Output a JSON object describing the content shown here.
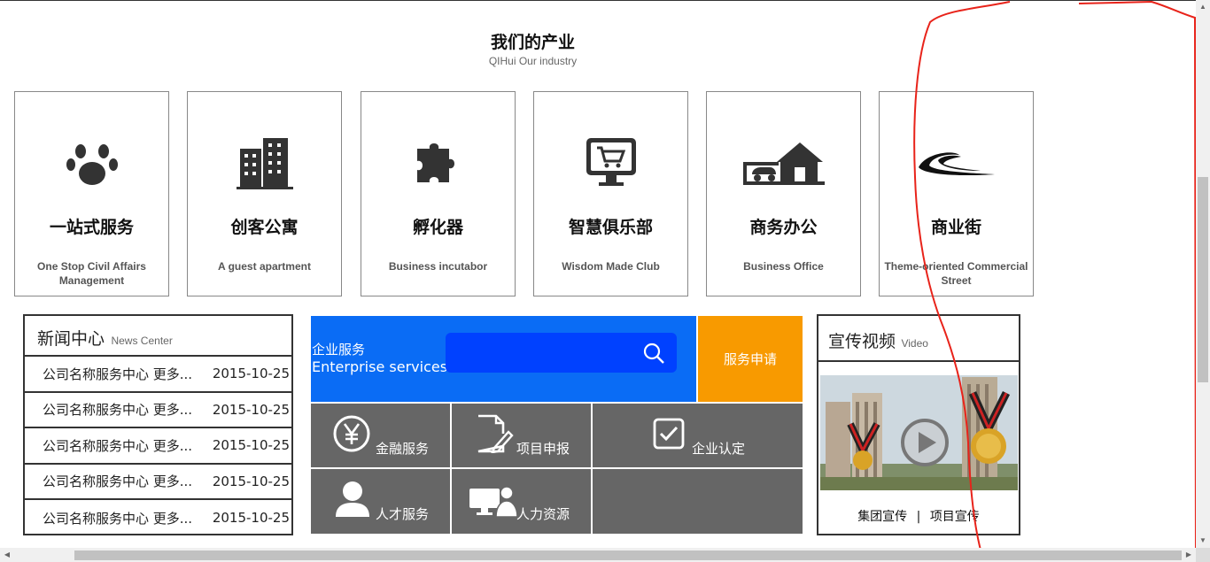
{
  "section": {
    "title": "我们的产业",
    "subtitle": "QIHui Our industry"
  },
  "industries": [
    {
      "cn": "一站式服务",
      "en": "One Stop Civil Affairs Management",
      "icon": "paw-icon"
    },
    {
      "cn": "创客公寓",
      "en": "A guest apartment",
      "icon": "buildings-icon"
    },
    {
      "cn": "孵化器",
      "en": "Business incutabor",
      "icon": "puzzle-icon"
    },
    {
      "cn": "智慧俱乐部",
      "en": "Wisdom Made Club",
      "icon": "cart-monitor-icon"
    },
    {
      "cn": "商务办公",
      "en": "Business Office",
      "icon": "house-car-icon"
    },
    {
      "cn": "商业街",
      "en": "Theme-oriented Commercial Street",
      "icon": "road-icon"
    }
  ],
  "news": {
    "title": "新闻中心",
    "subtitle": "News Center",
    "items": [
      {
        "title": "公司名称服务中心 更多...",
        "date": "2015-10-25"
      },
      {
        "title": "公司名称服务中心 更多...",
        "date": "2015-10-25"
      },
      {
        "title": "公司名称服务中心 更多...",
        "date": "2015-10-25"
      },
      {
        "title": "公司名称服务中心 更多...",
        "date": "2015-10-25"
      },
      {
        "title": "公司名称服务中心 更多...",
        "date": "2015-10-25"
      }
    ]
  },
  "enterprise": {
    "label_cn": "企业服务",
    "label_en": "Enterprise services",
    "apply": "服务申请"
  },
  "services": [
    {
      "label": "金融服务",
      "icon": "yen-icon"
    },
    {
      "label": "项目申报",
      "icon": "document-edit-icon"
    },
    {
      "label": "企业认定",
      "icon": "checkbox-icon"
    },
    {
      "label": "人才服务",
      "icon": "person-icon"
    },
    {
      "label": "人力资源",
      "icon": "computer-user-icon"
    }
  ],
  "video": {
    "title": "宣传视频",
    "subtitle": "Video",
    "link1": "集团宣传",
    "separator": "|",
    "link2": "项目宣传"
  },
  "colors": {
    "enterprise_bg": "#0a6cf5",
    "search_bg": "#0041ff",
    "apply_bg": "#f89a00",
    "tile_bg": "#666666",
    "annotation": "#e8231a"
  }
}
